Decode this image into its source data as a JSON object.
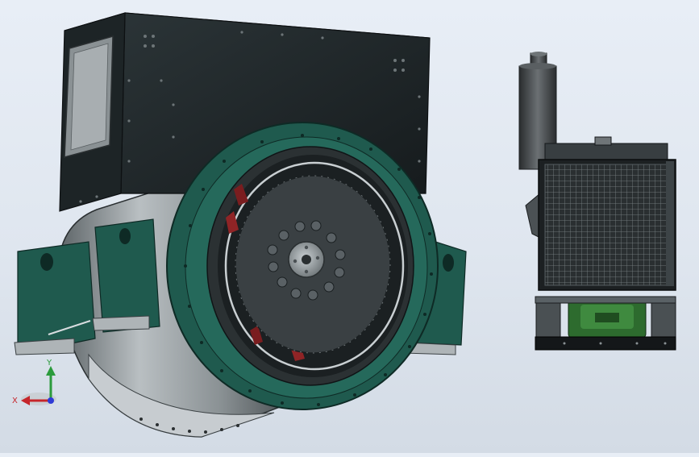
{
  "viewport": {
    "background_top": "#e8eef6",
    "background_bottom": "#d3dbe5"
  },
  "models": {
    "generator": {
      "housing_color": "#20282b",
      "frame_color": "#1f5a4e",
      "body_color": "#8d9497",
      "rotor_color": "#3a4043"
    },
    "genset_side_view": {
      "radiator_color": "#2b3032",
      "exhaust_color": "#45494b",
      "engine_color": "#2d6b2e"
    }
  },
  "triad": {
    "x_label": "X",
    "y_label": "Y",
    "x_color": "#c6262b",
    "y_color": "#2b9b3c",
    "z_color": "#2f3bd6"
  }
}
